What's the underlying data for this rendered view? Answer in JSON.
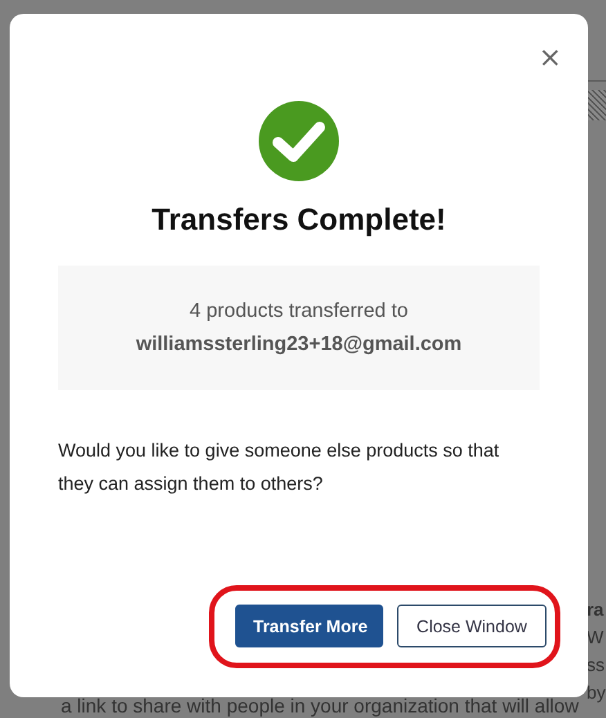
{
  "background": {
    "side_heading": "ra",
    "side_lines": [
      "W",
      "ss",
      "by"
    ],
    "bottom_line": "a link to share with people in your organization that will allow"
  },
  "dialog": {
    "close": "×",
    "title": "Transfers Complete!",
    "summary": {
      "count": "4",
      "text": "products transferred to",
      "email": "williamssterling23+18@gmail.com"
    },
    "question": "Would you like to give someone else products so that they can assign them to others?",
    "buttons": [
      {
        "label": "Transfer More",
        "kind": "primary"
      },
      {
        "label": "Close Window",
        "kind": "secondary"
      }
    ],
    "highlight": true
  }
}
